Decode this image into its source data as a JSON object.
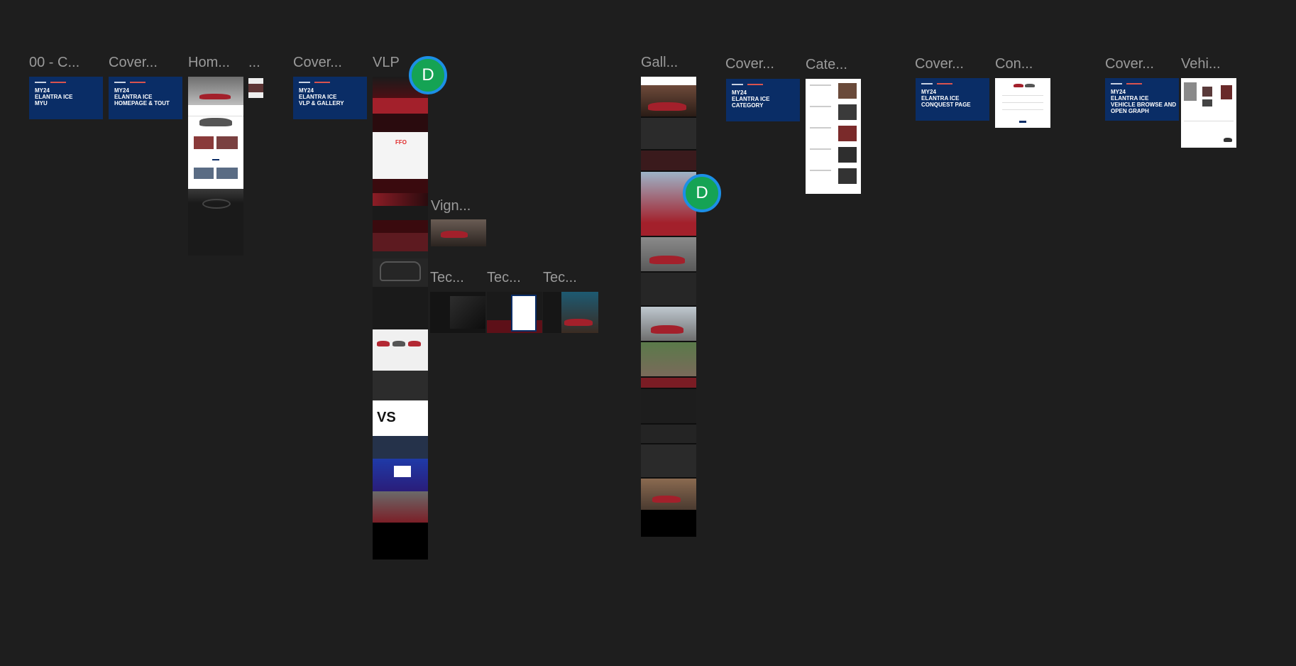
{
  "canvas": {
    "labels": {
      "l1": "00 - C...",
      "l2": "Cover...",
      "l3": "Hom...",
      "l4": "...",
      "l5": "Cover...",
      "l6": "VLP",
      "l7": "Vign...",
      "l8": "Tec...",
      "l9": "Tec...",
      "l10": "Tec...",
      "l11": "Gall...",
      "l12": "Cover...",
      "l13": "Cate...",
      "l14": "Cover...",
      "l15": "Con...",
      "l16": "Cover...",
      "l17": "Vehi..."
    },
    "covers": {
      "c1": "MY24\nELANTRA ICE\nMYU",
      "c2": "MY24\nELANTRA ICE\nHOMEPAGE & TOUT",
      "c3": "MY24\nELANTRA ICE\nVLP & GALLERY",
      "c4": "MY24\nELANTRA ICE\nCATEGORY",
      "c5": "MY24\nELANTRA ICE\nCONQUEST PAGE",
      "c6": "MY24\nELANTRA ICE\nVEHICLE BROWSE AND\nOPEN GRAPH"
    },
    "avatars": {
      "a1": "D",
      "a2": "D"
    },
    "ffo_text": "FFO",
    "vs_text": "VS"
  },
  "colors": {
    "canvas_bg": "#1e1e1e",
    "label": "#9a9a9a",
    "cover_bg": "#0a2d66",
    "avatar_fill": "#15a354",
    "avatar_ring": "#1c8fe6",
    "accent_red": "#a3202b"
  },
  "icons": [
    "user-avatar"
  ]
}
